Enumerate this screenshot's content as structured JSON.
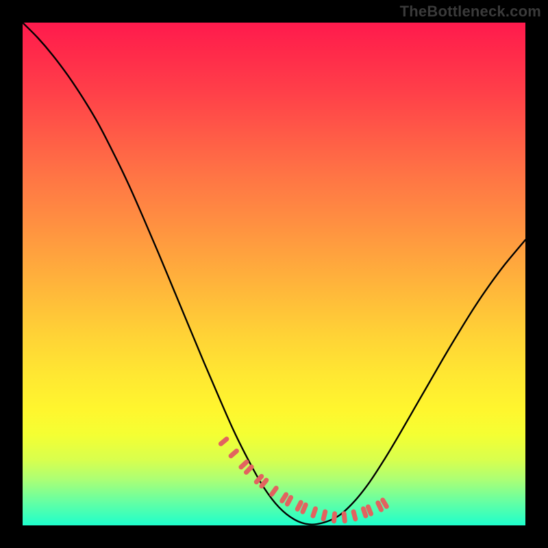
{
  "watermark": "TheBottleneck.com",
  "colors": {
    "frame": "#000000",
    "curve": "#000000",
    "markers": "#e2635f",
    "gradient_top": "#ff1a4d",
    "gradient_bottom": "#1effcc"
  },
  "chart_data": {
    "type": "line",
    "title": "",
    "xlabel": "",
    "ylabel": "",
    "xlim": [
      0,
      100
    ],
    "ylim": [
      0,
      100
    ],
    "series": [
      {
        "name": "bottleneck-curve",
        "x": [
          0,
          3,
          6,
          9,
          12,
          15,
          18,
          21,
          24,
          27,
          30,
          33,
          36,
          39,
          42,
          45,
          48,
          51,
          54,
          57,
          60,
          63,
          66,
          69,
          72,
          75,
          78,
          81,
          84,
          87,
          90,
          93,
          96,
          100
        ],
        "y": [
          100,
          97,
          93.5,
          89.5,
          85,
          80,
          74.2,
          68,
          61.2,
          54.2,
          47,
          39.8,
          32.6,
          25.6,
          18.8,
          12.8,
          7.5,
          3.6,
          1.2,
          0.2,
          0.6,
          2.0,
          4.8,
          8.6,
          13.2,
          18.2,
          23.4,
          28.6,
          33.8,
          38.8,
          43.6,
          48.0,
          52.0,
          56.8
        ]
      }
    ],
    "markers": {
      "name": "highlighted-points",
      "x": [
        40,
        42,
        44,
        45,
        47,
        48,
        50,
        52,
        53,
        55,
        56,
        58,
        60,
        62,
        64,
        66,
        68,
        69,
        71,
        72
      ],
      "y": [
        16.7,
        14.3,
        12.1,
        11.1,
        9.2,
        8.4,
        6.8,
        5.5,
        4.9,
        3.9,
        3.4,
        2.6,
        2.0,
        1.6,
        1.6,
        2.0,
        2.6,
        3.0,
        3.8,
        4.4
      ]
    }
  }
}
